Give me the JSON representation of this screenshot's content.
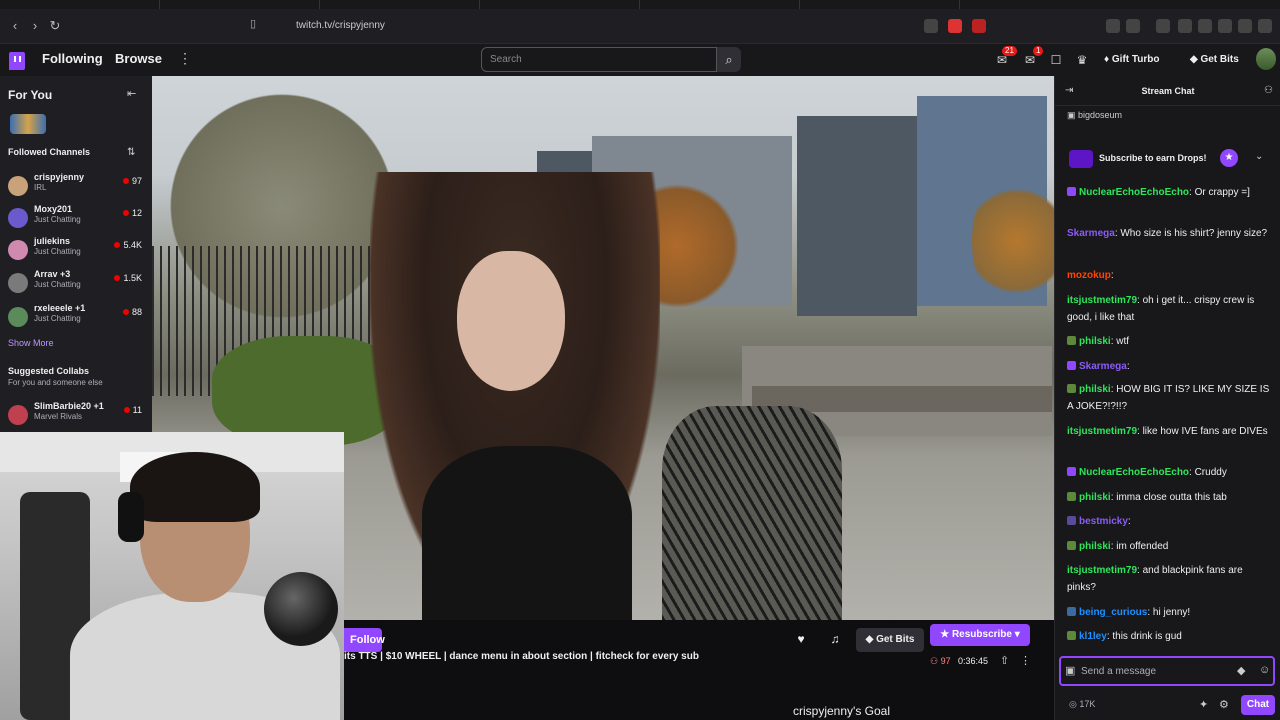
{
  "browser": {
    "url": "twitch.tv/crispyjenny"
  },
  "nav": {
    "following": "Following",
    "browse": "Browse",
    "more": "⋮",
    "search_placeholder": "Search",
    "notif_badge": "21",
    "inbox_badge": "1",
    "gift_turbo": "Gift Turbo",
    "get_bits": "Get Bits"
  },
  "sidebar": {
    "for_you": "For You",
    "followed_heading": "Followed Channels",
    "channels": [
      {
        "name": "crispyjenny",
        "category": "IRL",
        "viewers": "97",
        "color": "#c9a27a"
      },
      {
        "name": "Moxy201",
        "category": "Just Chatting",
        "viewers": "12",
        "color": "#6a5acd"
      },
      {
        "name": "juliekins",
        "category": "Just Chatting",
        "viewers": "5.4K",
        "color": "#d08ab0"
      },
      {
        "name": "Arrav +3",
        "category": "Just Chatting",
        "viewers": "1.5K",
        "color": "#7a7a7a"
      },
      {
        "name": "rxeleeele +1",
        "category": "Just Chatting",
        "viewers": "88",
        "color": "#5b8a5b"
      }
    ],
    "show_more": "Show More",
    "suggested_heading": "Suggested Collabs",
    "suggested_sub": "For you and someone else",
    "suggested": [
      {
        "name": "SlimBarbie20 +1",
        "category": "Marvel Rivals",
        "viewers": "11",
        "color": "#c04050"
      }
    ]
  },
  "player": {
    "follow": "Follow",
    "get_bits": "Get Bits",
    "resubscribe": "Resubscribe",
    "title": "its TTS | $10 WHEEL | dance menu in about section | fitcheck for every sub",
    "viewers": "97",
    "uptime": "0:36:45",
    "goal": "crispyjenny's Goal"
  },
  "chat": {
    "title": "Stream Chat",
    "pinned": "bigdoseum",
    "drops_text": "Subscribe to earn Drops!",
    "placeholder": "Send a message",
    "points": "17K",
    "chat_button": "Chat",
    "messages": [
      {
        "user": "NuclearEchoEchoEcho",
        "color": "#2ee65a",
        "text": ": Or crappy =]"
      },
      {
        "user": "Skarmega",
        "color": "#8a5cf5",
        "text": ": Who size is his shirt? jenny size?"
      },
      {
        "user": "mozokup",
        "color": "#ff4500",
        "text": ":"
      },
      {
        "user": "itsjustmetim79",
        "color": "#2ee65a",
        "text": ": oh i get it... crispy crew is good, i like that"
      },
      {
        "user": "philski",
        "color": "#2ee65a",
        "text": ": wtf"
      },
      {
        "user": "Skarmega",
        "color": "#8a5cf5",
        "text": ":"
      },
      {
        "user": "philski",
        "color": "#2ee65a",
        "text": ": HOW BIG IT IS? LIKE MY SIZE IS A JOKE?!?!!?"
      },
      {
        "user": "itsjustmetim79",
        "color": "#2ee65a",
        "text": ": like how IVE fans are DIVEs"
      },
      {
        "user": "NuclearEchoEchoEcho",
        "color": "#2ee65a",
        "text": ": Cruddy"
      },
      {
        "user": "philski",
        "color": "#2ee65a",
        "text": ": imma close outta this tab"
      },
      {
        "user": "bestmicky",
        "color": "#8a5cf5",
        "text": ":"
      },
      {
        "user": "philski",
        "color": "#2ee65a",
        "text": ": im offended"
      },
      {
        "user": "itsjustmetim79",
        "color": "#2ee65a",
        "text": ": and blackpink fans are pinks?"
      },
      {
        "user": "being_curious",
        "color": "#1e90ff",
        "text": ": hi jenny!"
      },
      {
        "user": "kl1ley",
        "color": "#1e90ff",
        "text": ": this drink is gud"
      }
    ]
  }
}
